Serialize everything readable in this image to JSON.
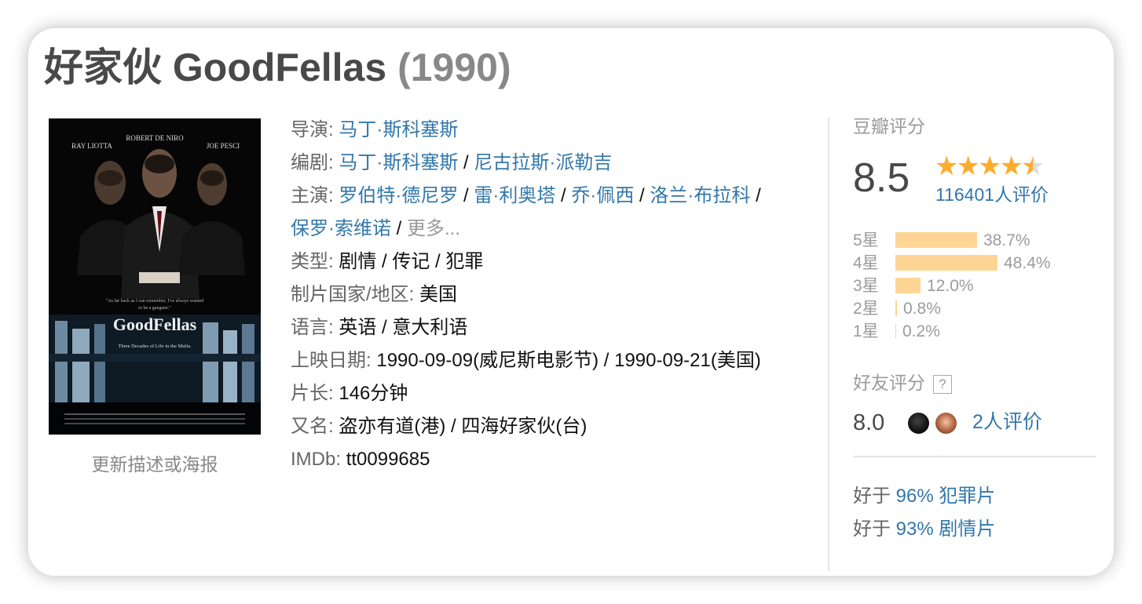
{
  "title": {
    "name": "好家伙 GoodFellas",
    "year": "(1990)"
  },
  "poster": {
    "cast_top": [
      "RAY LIOTTA",
      "ROBERT DE NIRO",
      "JOE PESCI"
    ],
    "quote": "\"As far back as I can remember, I've always wanted to be a gangster.\"",
    "logo": "GoodFellas",
    "tagline": "Three Decades of Life in the Mafia."
  },
  "update_link": "更新描述或海报",
  "info": {
    "director_label": "导演:",
    "directors": [
      "马丁·斯科塞斯"
    ],
    "writer_label": "编剧:",
    "writers": [
      "马丁·斯科塞斯",
      "尼古拉斯·派勒吉"
    ],
    "cast_label": "主演:",
    "cast": [
      "罗伯特·德尼罗",
      "雷·利奥塔",
      "乔·佩西",
      "洛兰·布拉科",
      "保罗·索维诺"
    ],
    "more": "更多...",
    "genre_label": "类型:",
    "genre": "剧情 / 传记 / 犯罪",
    "country_label": "制片国家/地区:",
    "country": "美国",
    "language_label": "语言:",
    "language": "英语 / 意大利语",
    "release_label": "上映日期:",
    "release": "1990-09-09(威尼斯电影节) / 1990-09-21(美国)",
    "runtime_label": "片长:",
    "runtime": "146分钟",
    "aka_label": "又名:",
    "aka": "盗亦有道(港) / 四海好家伙(台)",
    "imdb_label": "IMDb:",
    "imdb": "tt0099685"
  },
  "rating": {
    "label": "豆瓣评分",
    "score": "8.5",
    "stars": 4.5,
    "count": "116401人评价",
    "distribution": [
      {
        "label": "5星",
        "percent": 38.7,
        "text": "38.7%"
      },
      {
        "label": "4星",
        "percent": 48.4,
        "text": "48.4%"
      },
      {
        "label": "3星",
        "percent": 12.0,
        "text": "12.0%"
      },
      {
        "label": "2星",
        "percent": 0.8,
        "text": "0.8%"
      },
      {
        "label": "1星",
        "percent": 0.2,
        "text": "0.2%"
      }
    ],
    "bar_color": "#ffd596",
    "star_color": "#ffac2d"
  },
  "friends": {
    "label": "好友评分",
    "help": "?",
    "score": "8.0",
    "count": "2人评价"
  },
  "better_than": [
    {
      "prefix": "好于",
      "value": "96% 犯罪片"
    },
    {
      "prefix": "好于",
      "value": "93% 剧情片"
    }
  ],
  "colors": {
    "link": "#3377aa",
    "muted": "#9b9b9b"
  }
}
